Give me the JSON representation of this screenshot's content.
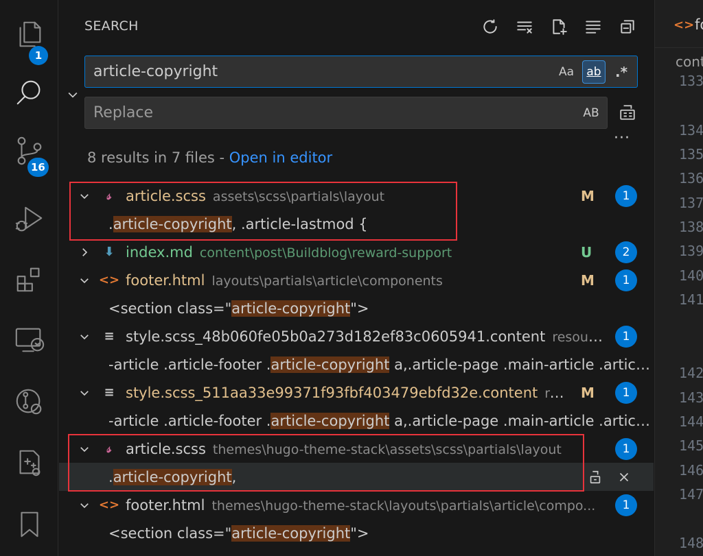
{
  "activity_bar": {
    "explorer_badge": "1",
    "scm_badge": "16"
  },
  "search": {
    "title": "SEARCH",
    "query": "article-copyright",
    "replace_placeholder": "Replace",
    "match_case_label": "Aa",
    "whole_word_label": "ab",
    "regex_label": ".*",
    "preserve_case_label": "AB",
    "summary_text": "8 results in 7 files - ",
    "open_in_editor": "Open in editor"
  },
  "results": [
    {
      "name": "article.scss",
      "path": "assets\\scss\\partials\\layout",
      "status": "M",
      "count": "1",
      "icon": "sass-icon",
      "expanded": true
    },
    {
      "name": "index.md",
      "path": "content\\post\\Buildblog\\reward-support",
      "status": "U",
      "count": "2",
      "icon": "markdown-icon",
      "expanded": false
    },
    {
      "name": "footer.html",
      "path": "layouts\\partials\\article\\components",
      "status": "M",
      "count": "1",
      "icon": "html-icon",
      "expanded": true
    },
    {
      "name": "style.scss_48b060fe05b0a273d182ef83c0605941.content",
      "path": "resource...",
      "status": "",
      "count": "1",
      "icon": "text-file-icon",
      "expanded": true
    },
    {
      "name": "style.scss_511aa33e99371f93fbf403479ebfd32e.content",
      "path": "res...",
      "status": "M",
      "count": "1",
      "icon": "text-file-icon",
      "expanded": true
    },
    {
      "name": "article.scss",
      "path": "themes\\hugo-theme-stack\\assets\\scss\\partials\\layout",
      "status": "",
      "count": "1",
      "icon": "sass-icon",
      "expanded": true
    },
    {
      "name": "footer.html",
      "path": "themes\\hugo-theme-stack\\layouts\\partials\\article\\compo...",
      "status": "",
      "count": "1",
      "icon": "html-icon",
      "expanded": true
    }
  ],
  "matches": [
    {
      "before": ".",
      "hit": "article-copyright",
      "after": ", .article-lastmod {"
    },
    {
      "before": "<section class=\"",
      "hit": "article-copyright",
      "after": "\">"
    },
    {
      "before": "-article .article-footer .",
      "hit": "article-copyright",
      "after": " a,.article-page .main-article .articl..."
    },
    {
      "before": "-article .article-footer .",
      "hit": "article-copyright",
      "after": " a,.article-page .main-article .articl..."
    },
    {
      "before": ".",
      "hit": "article-copyright",
      "after": ","
    },
    {
      "before": "<section class=\"",
      "hit": "article-copyright",
      "after": "\">"
    }
  ],
  "editor": {
    "tab_icon": "<>",
    "tab_label": "fo",
    "breadcrumb": "cont",
    "line_numbers": [
      "133",
      "134",
      "135",
      "136",
      "137",
      "138",
      "139",
      "140",
      "141",
      "142",
      "143",
      "144",
      "145",
      "146",
      "147",
      "148"
    ]
  },
  "colors": {
    "accent": "#0078d4",
    "highlight": "#623315",
    "modified": "#e2c08d",
    "untracked": "#73c991",
    "annotation_box": "#e8333b"
  }
}
